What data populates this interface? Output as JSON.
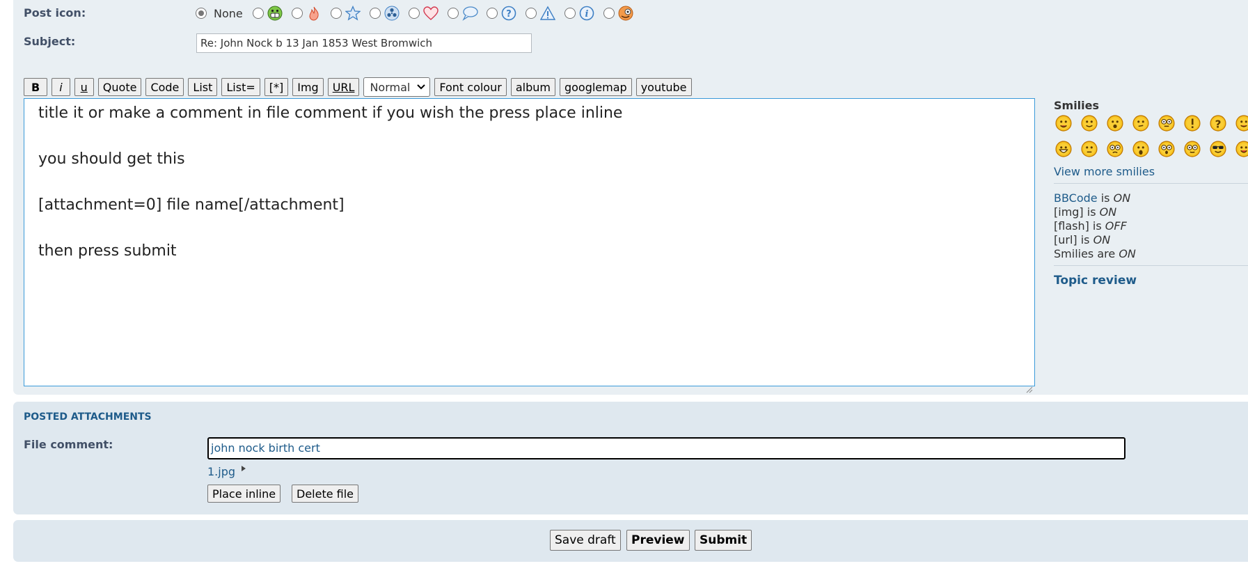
{
  "post_icon": {
    "label": "Post icon:",
    "none_label": "None",
    "icons": [
      "grin-icon",
      "fire-icon",
      "star-icon",
      "radioactive-icon",
      "heart-icon",
      "speech-bubble-icon",
      "question-icon",
      "warning-icon",
      "info-icon",
      "mrgreen-icon"
    ]
  },
  "subject": {
    "label": "Subject:",
    "value": "Re: John Nock b 13 Jan 1853 West Bromwich"
  },
  "toolbar": {
    "bold": "B",
    "italic": "i",
    "underline": "u",
    "quote": "Quote",
    "code": "Code",
    "list": "List",
    "list_numbered": "List=",
    "list_item": "[*]",
    "img": "Img",
    "url": "URL",
    "font_size": "Normal",
    "font_colour": "Font colour",
    "album": "album",
    "googlemap": "googlemap",
    "youtube": "youtube"
  },
  "message": {
    "text": "title it or make a comment in file comment if you wish the press place inline\n\nyou should get this\n\n[attachment=0] file name[/attachment]\n\nthen press submit"
  },
  "smilies": {
    "title": "Smilies",
    "view_more": "View more smilies",
    "row1": [
      "smile-icon",
      "wink-icon",
      "surprised-icon",
      "confused-icon",
      "geek-icon",
      "exclamation-icon",
      "question-smiley-icon",
      "razz-icon"
    ],
    "row2": [
      "laugh-icon",
      "neutral-icon",
      "ugeek-icon",
      "shocked-icon",
      "eek-icon",
      "rolleyes-icon",
      "cool-icon",
      "tongue-icon"
    ]
  },
  "bbcode_status": {
    "bbcode_link": "BBCode",
    "bbcode_is": " is ",
    "bbcode_val": "ON",
    "img_label": "[img] is ",
    "img_val": "ON",
    "flash_label": "[flash] is ",
    "flash_val": "OFF",
    "url_label": "[url] is ",
    "url_val": "ON",
    "smilies_label": "Smilies are ",
    "smilies_val": "ON"
  },
  "topic_review": "Topic review",
  "attachments": {
    "title": "POSTED ATTACHMENTS",
    "file_comment_label": "File comment:",
    "file_comment_value": "john nock birth cert",
    "file_name": "1.jpg",
    "place_inline": "Place inline",
    "delete_file": "Delete file"
  },
  "submit_bar": {
    "save_draft": "Save draft",
    "preview": "Preview",
    "submit": "Submit"
  },
  "colors": {
    "panel": "#e9eff3",
    "link": "#1e5b8a",
    "label": "#425067",
    "focus": "#3a9ad9"
  }
}
